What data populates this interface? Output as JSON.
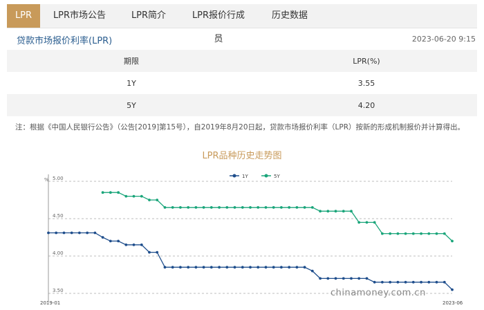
{
  "tabs": [
    {
      "label": "LPR",
      "active": true
    },
    {
      "label": "LPR市场公告",
      "active": false
    },
    {
      "label": "LPR简介",
      "active": false
    },
    {
      "label": "LPR报价行成员",
      "active": false
    },
    {
      "label": "历史数据",
      "active": false
    }
  ],
  "section": {
    "title": "贷款市场报价利率(LPR)",
    "timestamp": "2023-06-20 9:15"
  },
  "rates_table": {
    "headers": [
      "期限",
      "LPR(%)"
    ],
    "rows": [
      [
        "1Y",
        "3.55"
      ],
      [
        "5Y",
        "4.20"
      ]
    ]
  },
  "note": "注：根据《中国人民银行公告》（公告[2019]第15号），自2019年8月20日起，贷款市场报价利率（LPR）按新的形成机制报价并计算得出。",
  "watermark": "chinamoney.com.cn",
  "colors": {
    "accent": "#c89a5a",
    "series_1y": "#1f4e8c",
    "series_5y": "#1aa57a"
  },
  "chart_data": {
    "type": "line",
    "title": "LPR品种历史走势图",
    "ylabel": "%",
    "ylim": [
      3.5,
      5.0
    ],
    "yticks": [
      "5.00",
      "4.50",
      "4.00",
      "3.50"
    ],
    "x_tick_labels": [
      "2019-01",
      "2023-06"
    ],
    "legend_position": "top-center",
    "grid": true,
    "series": [
      {
        "name": "1Y",
        "values": [
          4.31,
          4.31,
          4.31,
          4.31,
          4.31,
          4.31,
          4.31,
          4.25,
          4.2,
          4.2,
          4.15,
          4.15,
          4.15,
          4.05,
          4.05,
          3.85,
          3.85,
          3.85,
          3.85,
          3.85,
          3.85,
          3.85,
          3.85,
          3.85,
          3.85,
          3.85,
          3.85,
          3.85,
          3.85,
          3.85,
          3.85,
          3.85,
          3.85,
          3.85,
          3.8,
          3.7,
          3.7,
          3.7,
          3.7,
          3.7,
          3.7,
          3.7,
          3.65,
          3.65,
          3.65,
          3.65,
          3.65,
          3.65,
          3.65,
          3.65,
          3.65,
          3.65,
          3.55
        ]
      },
      {
        "name": "5Y",
        "values": [
          null,
          null,
          null,
          null,
          null,
          null,
          null,
          4.85,
          4.85,
          4.85,
          4.8,
          4.8,
          4.8,
          4.75,
          4.75,
          4.65,
          4.65,
          4.65,
          4.65,
          4.65,
          4.65,
          4.65,
          4.65,
          4.65,
          4.65,
          4.65,
          4.65,
          4.65,
          4.65,
          4.65,
          4.65,
          4.65,
          4.65,
          4.65,
          4.65,
          4.6,
          4.6,
          4.6,
          4.6,
          4.6,
          4.45,
          4.45,
          4.45,
          4.3,
          4.3,
          4.3,
          4.3,
          4.3,
          4.3,
          4.3,
          4.3,
          4.3,
          4.2
        ]
      }
    ]
  }
}
